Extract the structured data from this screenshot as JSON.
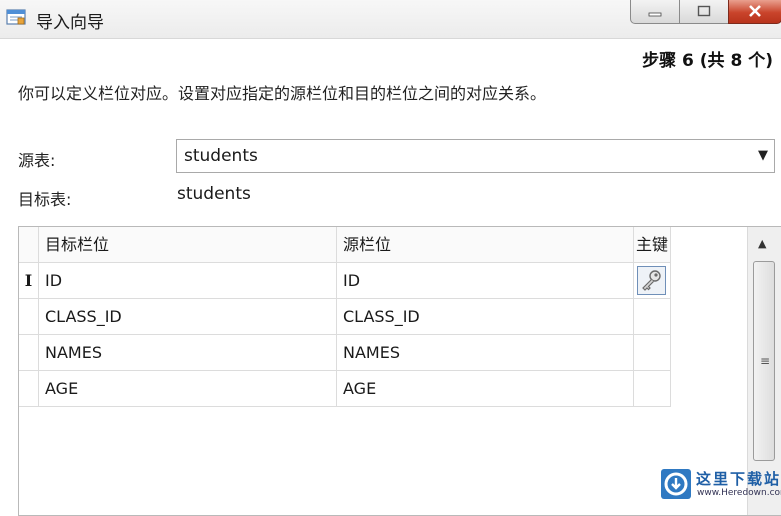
{
  "window": {
    "title": "导入向导"
  },
  "step": "步骤 6 (共 8 个)",
  "description": "你可以定义栏位对应。设置对应指定的源栏位和目的栏位之间的对应关系。",
  "source_table": {
    "label": "源表:",
    "value": "students"
  },
  "target_table": {
    "label": "目标表:",
    "value": "students"
  },
  "grid": {
    "columns": [
      "目标栏位",
      "源栏位",
      "主键"
    ],
    "rows": [
      {
        "target": "ID",
        "source": "ID",
        "primary_key": true,
        "current": true
      },
      {
        "target": "CLASS_ID",
        "source": "CLASS_ID",
        "primary_key": false,
        "current": false
      },
      {
        "target": "NAMES",
        "source": "NAMES",
        "primary_key": false,
        "current": false
      },
      {
        "target": "AGE",
        "source": "AGE",
        "primary_key": false,
        "current": false
      }
    ],
    "row_indicator": "I"
  },
  "watermark": {
    "text": "这里下载站",
    "url": "www.Heredown.com"
  },
  "icons": {
    "app": "import-wizard-icon",
    "minimize": "minimize-icon",
    "maximize": "maximize-icon",
    "close": "close-icon",
    "dropdown": "chevron-down-icon",
    "primary_key": "key-icon",
    "scroll_up": "scroll-up-icon"
  }
}
